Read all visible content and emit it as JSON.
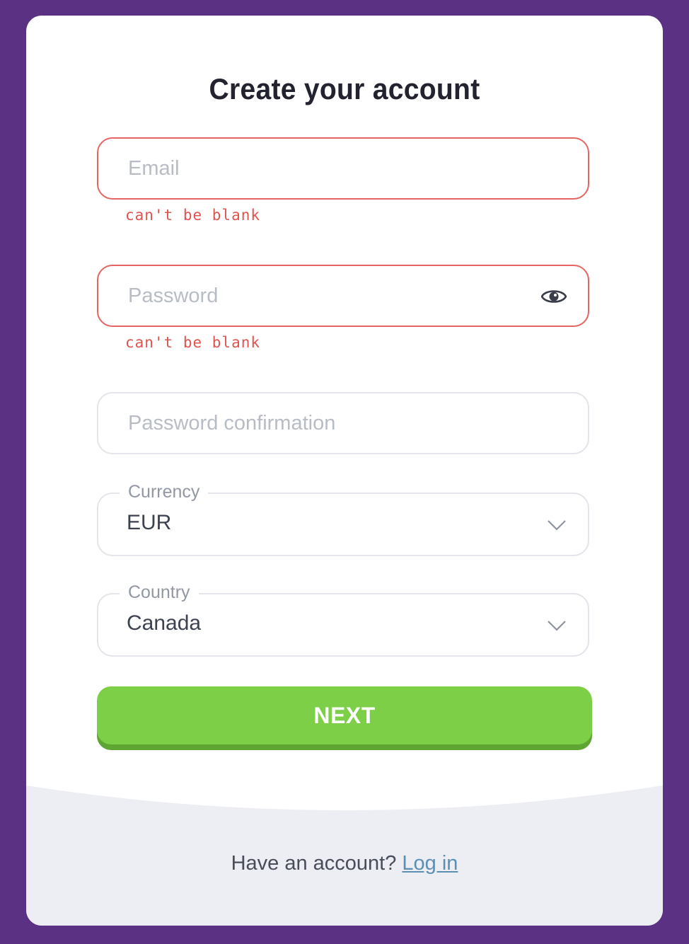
{
  "form": {
    "title": "Create your account",
    "email": {
      "placeholder": "Email",
      "value": "",
      "error": "can't be blank"
    },
    "password": {
      "placeholder": "Password",
      "value": "",
      "error": "can't be blank",
      "toggle_icon": "eye-icon"
    },
    "password_confirmation": {
      "placeholder": "Password confirmation",
      "value": ""
    },
    "currency": {
      "label": "Currency",
      "value": "EUR",
      "icon": "chevron-down-icon"
    },
    "country": {
      "label": "Country",
      "value": "Canada",
      "icon": "chevron-down-icon"
    },
    "next_label": "NEXT"
  },
  "footer": {
    "prompt": "Have an account? ",
    "login_label": "Log in"
  },
  "colors": {
    "background": "#5b3184",
    "card": "#ffffff",
    "error": "#e0534f",
    "primary_button": "#7ccf47",
    "link": "#5d8fb3",
    "footer_bg": "#eceef4"
  }
}
